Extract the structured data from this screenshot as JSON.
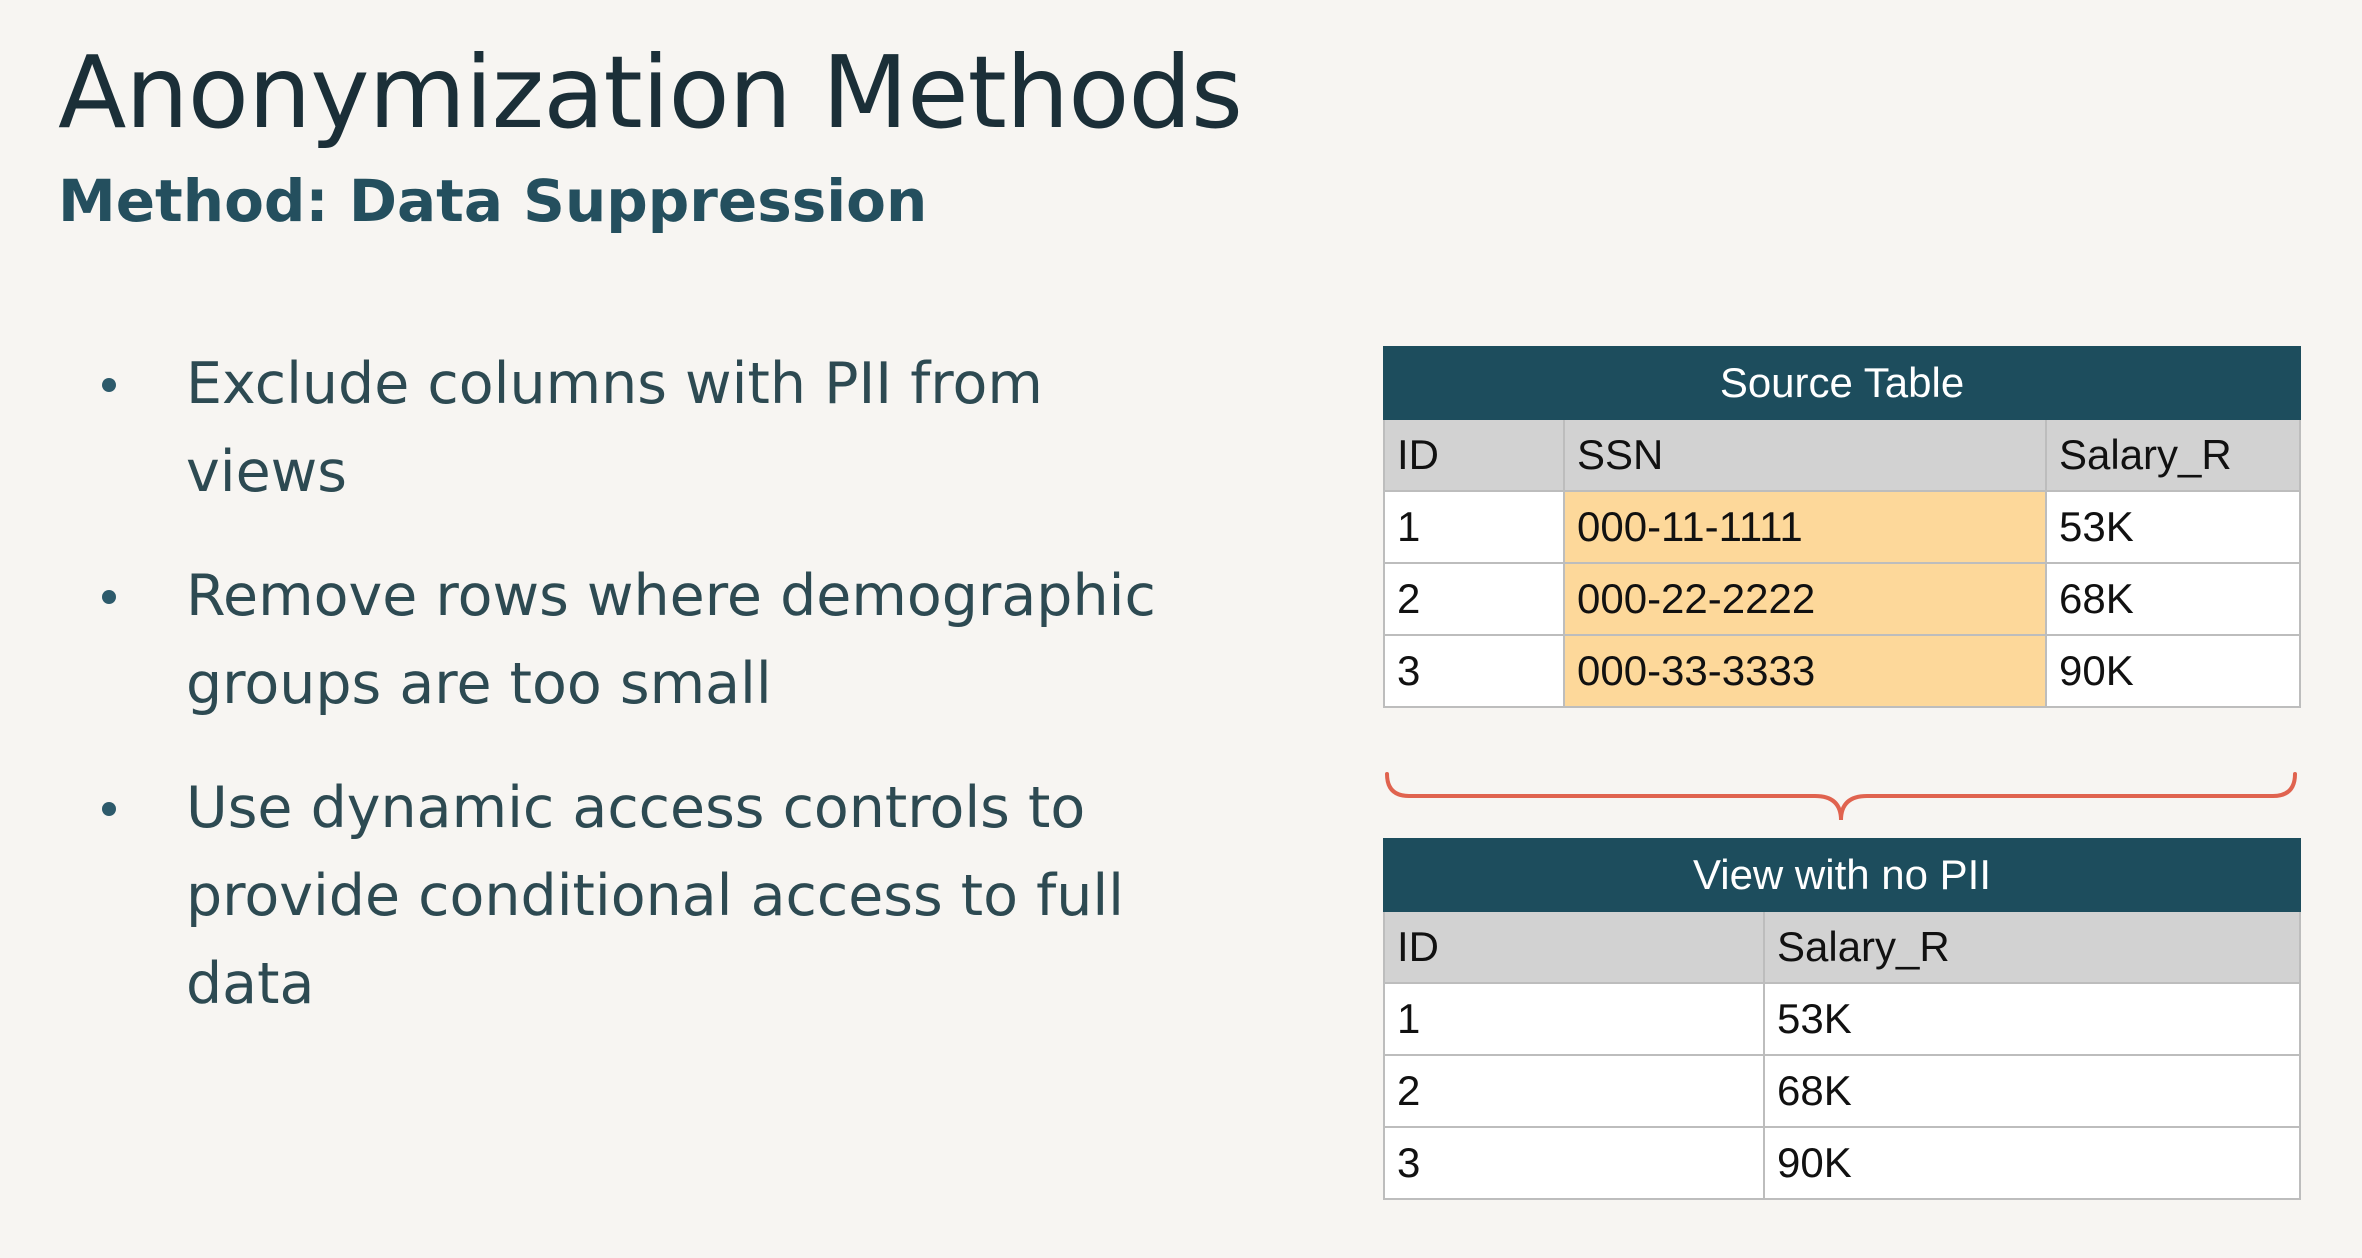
{
  "slide": {
    "title": "Anonymization Methods",
    "subtitle_prefix": "Method: ",
    "subtitle_method": "Data Suppression"
  },
  "bullets": [
    "Exclude columns with PII from views",
    "Remove rows where demographic groups are too small",
    "Use dynamic access controls to provide conditional access to full data"
  ],
  "source_table": {
    "title": "Source Table",
    "headers": [
      "ID",
      "SSN",
      "Salary_R"
    ],
    "rows": [
      [
        "1",
        "000-11-1111",
        "53K"
      ],
      [
        "2",
        "000-22-2222",
        "68K"
      ],
      [
        "3",
        "000-33-3333",
        "90K"
      ]
    ]
  },
  "view_table": {
    "title": "View with no PII",
    "headers": [
      "ID",
      "Salary_R"
    ],
    "rows": [
      [
        "1",
        "53K"
      ],
      [
        "2",
        "68K"
      ],
      [
        "3",
        "90K"
      ]
    ]
  },
  "colors": {
    "table_header_bg": "#1d4d5d",
    "column_header_bg": "#d2d2d2",
    "pii_highlight": "#fdd89a",
    "brace": "#e0634f",
    "title_text": "#1b2f38",
    "subtitle_text": "#244f5e"
  }
}
